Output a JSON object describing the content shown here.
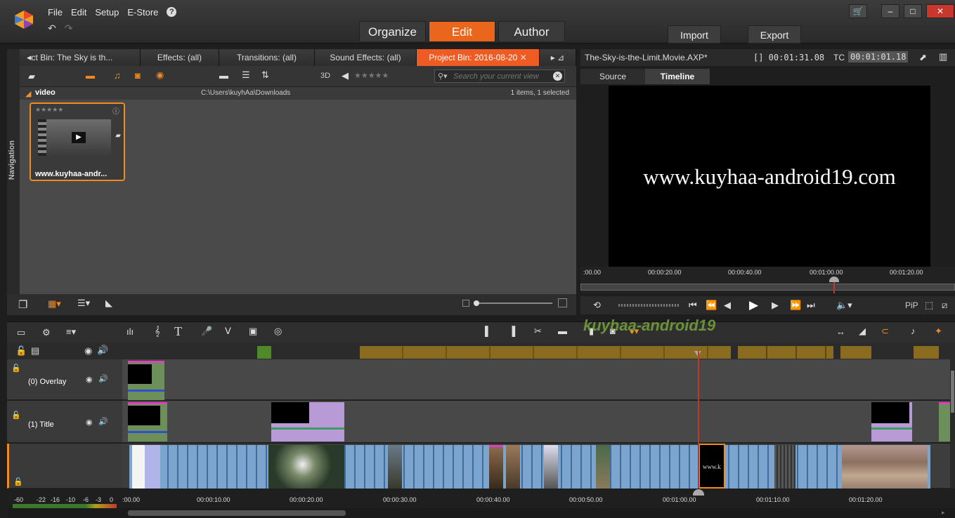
{
  "menu": [
    "File",
    "Edit",
    "Setup",
    "E-Store"
  ],
  "mode_tabs": [
    "Organize",
    "Edit",
    "Author"
  ],
  "io_buttons": [
    "Import",
    "Export"
  ],
  "library": {
    "tabs": [
      "ct Bin: The Sky is th...",
      "Effects: (all)",
      "Transitions: (all)",
      "Sound Effects: (all)",
      "Project Bin: 2016-08-20"
    ],
    "search_placeholder": "Search your current view",
    "folder_name": "video",
    "folder_path": "C:\\Users\\kuyhAa\\Downloads",
    "folder_status": "1 items, 1 selected",
    "navigation_label": "Navigation",
    "asset_label": "www.kuyhaa-andr...",
    "stars": "★★★★★",
    "three_d": "3D"
  },
  "player": {
    "project_name": "The-Sky-is-the-Limit.Movie.AXP*",
    "duration": "[] 00:01:31.08",
    "tc_label": "TC",
    "timecode": "00:01:01.18",
    "tabs": [
      "Source",
      "Timeline"
    ],
    "overlay_text": "www.kuyhaa-android19.com",
    "ruler_labels": [
      ":00.00",
      "00:00:20.00",
      "00:00:40.00",
      "00:01:00.00",
      "00:01:20.00"
    ],
    "pip_label": "PiP"
  },
  "watermark": "kuyhaa-android19",
  "timeline": {
    "tracks": [
      "(0) Overlay",
      "(1) Title"
    ],
    "ruler_labels": [
      ":00.00",
      "00:00:10.00",
      "00:00:20.00",
      "00:00:30.00",
      "00:00:40.00",
      "00:00:50.00",
      "00:01:00.00",
      "00:01:10.00",
      "00:01:20.00"
    ],
    "meter_labels": [
      "-60",
      "-22",
      "-16",
      "-10",
      "-6",
      "-3",
      "0"
    ],
    "clip_text": "www.k"
  },
  "colors": {
    "accent": "#ee5c24",
    "clip_blue": "#7ba4cf",
    "title_purple": "#b79ad6",
    "playhead": "#c0392b"
  }
}
